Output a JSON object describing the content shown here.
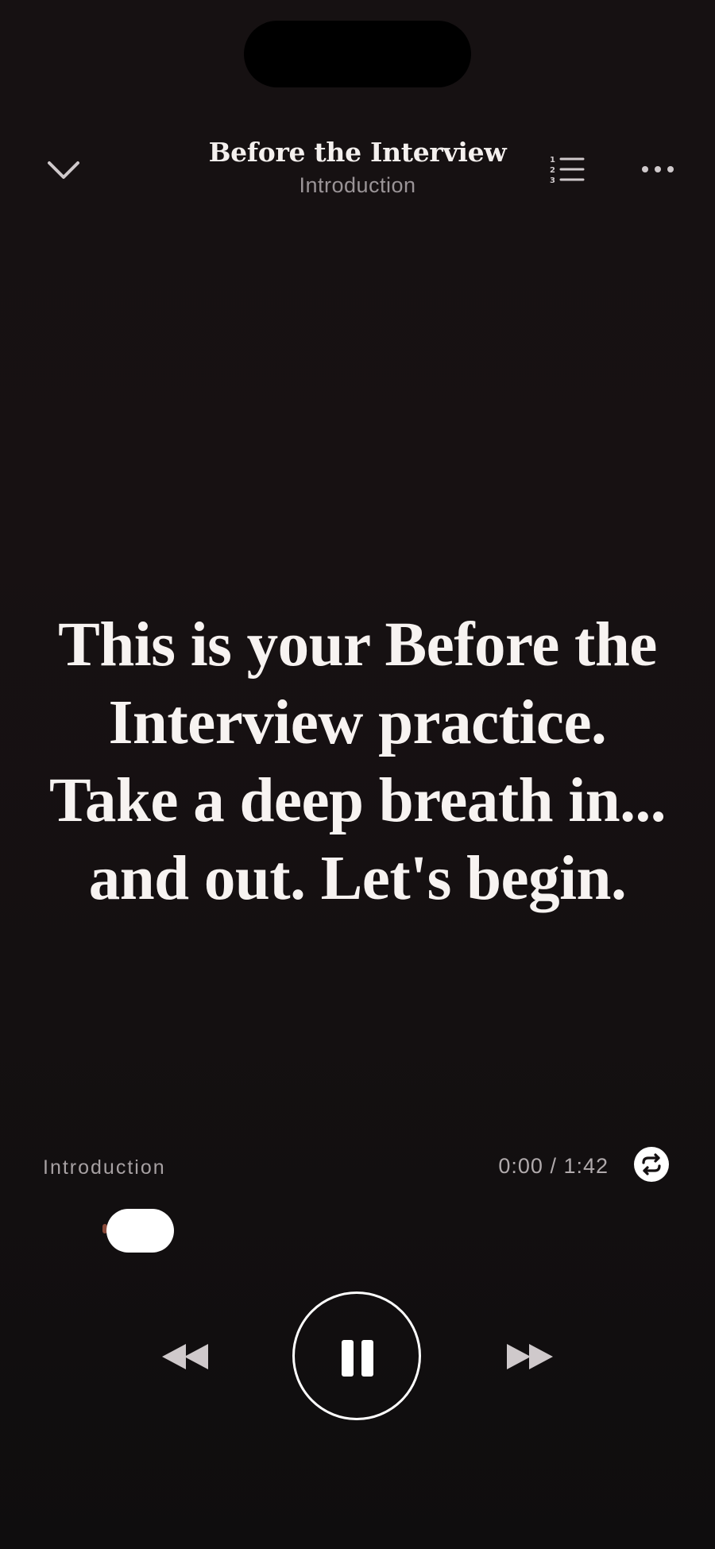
{
  "header": {
    "title": "Before the Interview",
    "subtitle": "Introduction"
  },
  "icons": {
    "collapse": "chevron-down-icon",
    "chapters": "numbered-list-icon",
    "more": "more-horizontal-icon",
    "repeat": "repeat-icon",
    "rewind": "rewind-icon",
    "pause": "pause-icon",
    "forward": "fast-forward-icon"
  },
  "content": {
    "quote": "This is your Before the Interview practice. Take a deep breath in... and out. Let's begin."
  },
  "player": {
    "track_label": "Introduction",
    "time": "0:00 / 1:42",
    "progress": 0
  },
  "colors": {
    "background": "#141011",
    "text": "#f7f3f1",
    "muted": "#9a9497",
    "accent": "#8a4a3a"
  }
}
